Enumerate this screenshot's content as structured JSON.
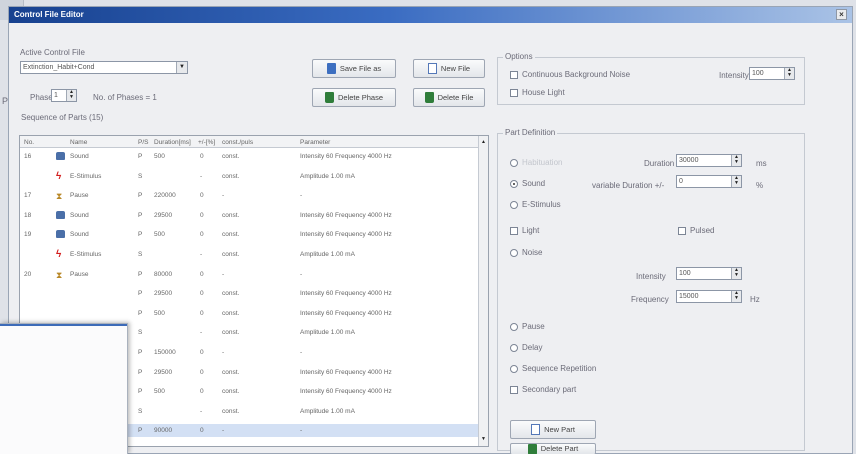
{
  "window": {
    "title": "Control File Editor",
    "close": "×"
  },
  "bg_window": {
    "top_label": "...",
    "phase_label": "Phas"
  },
  "active_file": {
    "label": "Active Control File",
    "value": "Extinction_Habit+Cond"
  },
  "buttons": {
    "save_as": "Save File as",
    "new_file": "New File",
    "delete_phase": "Delete Phase",
    "delete_file": "Delete File",
    "new_part": "New Part",
    "delete_part": "Delete Part"
  },
  "phase": {
    "label": "Phase",
    "value": "1",
    "count_label": "No. of Phases = 1"
  },
  "sequence_label": "Sequence of Parts (15)",
  "table": {
    "headers": [
      "No.",
      "Name",
      "P/S",
      "Duration[ms]",
      "+/-[%]",
      "const./puls",
      "Parameter"
    ],
    "rows": [
      {
        "no": "16",
        "icon": "sound",
        "name": "Sound",
        "ps": "P",
        "dur": "500",
        "var": "0",
        "cp": "const.",
        "param": "Intensity 60 Frequency 4000 Hz"
      },
      {
        "no": "",
        "icon": "stim",
        "name": "E-Stimulus",
        "ps": "S",
        "dur": "",
        "var": "-",
        "cp": "const.",
        "param": "Amplitude 1.00 mA"
      },
      {
        "no": "17",
        "icon": "pause",
        "name": "Pause",
        "ps": "P",
        "dur": "220000",
        "var": "0",
        "cp": "-",
        "param": "-"
      },
      {
        "no": "18",
        "icon": "sound",
        "name": "Sound",
        "ps": "P",
        "dur": "29500",
        "var": "0",
        "cp": "const.",
        "param": "Intensity 60 Frequency 4000 Hz"
      },
      {
        "no": "19",
        "icon": "sound",
        "name": "Sound",
        "ps": "P",
        "dur": "500",
        "var": "0",
        "cp": "const.",
        "param": "Intensity 60 Frequency 4000 Hz"
      },
      {
        "no": "",
        "icon": "stim",
        "name": "E-Stimulus",
        "ps": "S",
        "dur": "",
        "var": "-",
        "cp": "const.",
        "param": "Amplitude 1.00 mA"
      },
      {
        "no": "20",
        "icon": "pause",
        "name": "Pause",
        "ps": "P",
        "dur": "80000",
        "var": "0",
        "cp": "-",
        "param": "-"
      },
      {
        "no": "",
        "icon": "",
        "name": "",
        "ps": "P",
        "dur": "29500",
        "var": "0",
        "cp": "const.",
        "param": "Intensity 60 Frequency 4000 Hz"
      },
      {
        "no": "",
        "icon": "",
        "name": "",
        "ps": "P",
        "dur": "500",
        "var": "0",
        "cp": "const.",
        "param": "Intensity 60 Frequency 4000 Hz"
      },
      {
        "no": "",
        "icon": "",
        "name": "",
        "ps": "S",
        "dur": "",
        "var": "-",
        "cp": "const.",
        "param": "Amplitude 1.00 mA"
      },
      {
        "no": "",
        "icon": "",
        "name": "",
        "ps": "P",
        "dur": "150000",
        "var": "0",
        "cp": "-",
        "param": "-"
      },
      {
        "no": "",
        "icon": "",
        "name": "",
        "ps": "P",
        "dur": "29500",
        "var": "0",
        "cp": "const.",
        "param": "Intensity 60 Frequency 4000 Hz"
      },
      {
        "no": "",
        "icon": "",
        "name": "",
        "ps": "P",
        "dur": "500",
        "var": "0",
        "cp": "const.",
        "param": "Intensity 60 Frequency 4000 Hz"
      },
      {
        "no": "",
        "icon": "",
        "name": "",
        "ps": "S",
        "dur": "",
        "var": "-",
        "cp": "const.",
        "param": "Amplitude 1.00 mA"
      },
      {
        "no": "",
        "icon": "",
        "name": "",
        "ps": "P",
        "dur": "90000",
        "var": "0",
        "cp": "-",
        "param": "-",
        "selected": true
      }
    ]
  },
  "options": {
    "title": "Options",
    "continuous_noise": "Continuous Background Noise",
    "intensity_label": "Intensity",
    "intensity_value": "100",
    "house_light": "House Light"
  },
  "part_def": {
    "title": "Part Definition",
    "habituation": "Habituation",
    "duration_label": "Duration",
    "duration_value": "30000",
    "duration_unit": "ms",
    "sound": "Sound",
    "variable_label": "variable Duration +/-",
    "variable_value": "0",
    "variable_unit": "%",
    "estim": "E-Stimulus",
    "light": "Light",
    "pulsed": "Pulsed",
    "noise": "Noise",
    "intensity_label": "Intensity",
    "intensity_value": "100",
    "frequency_label": "Frequency",
    "frequency_value": "15000",
    "frequency_unit": "Hz",
    "pause": "Pause",
    "delay": "Delay",
    "repetition": "Sequence Repetition",
    "secondary": "Secondary part"
  }
}
